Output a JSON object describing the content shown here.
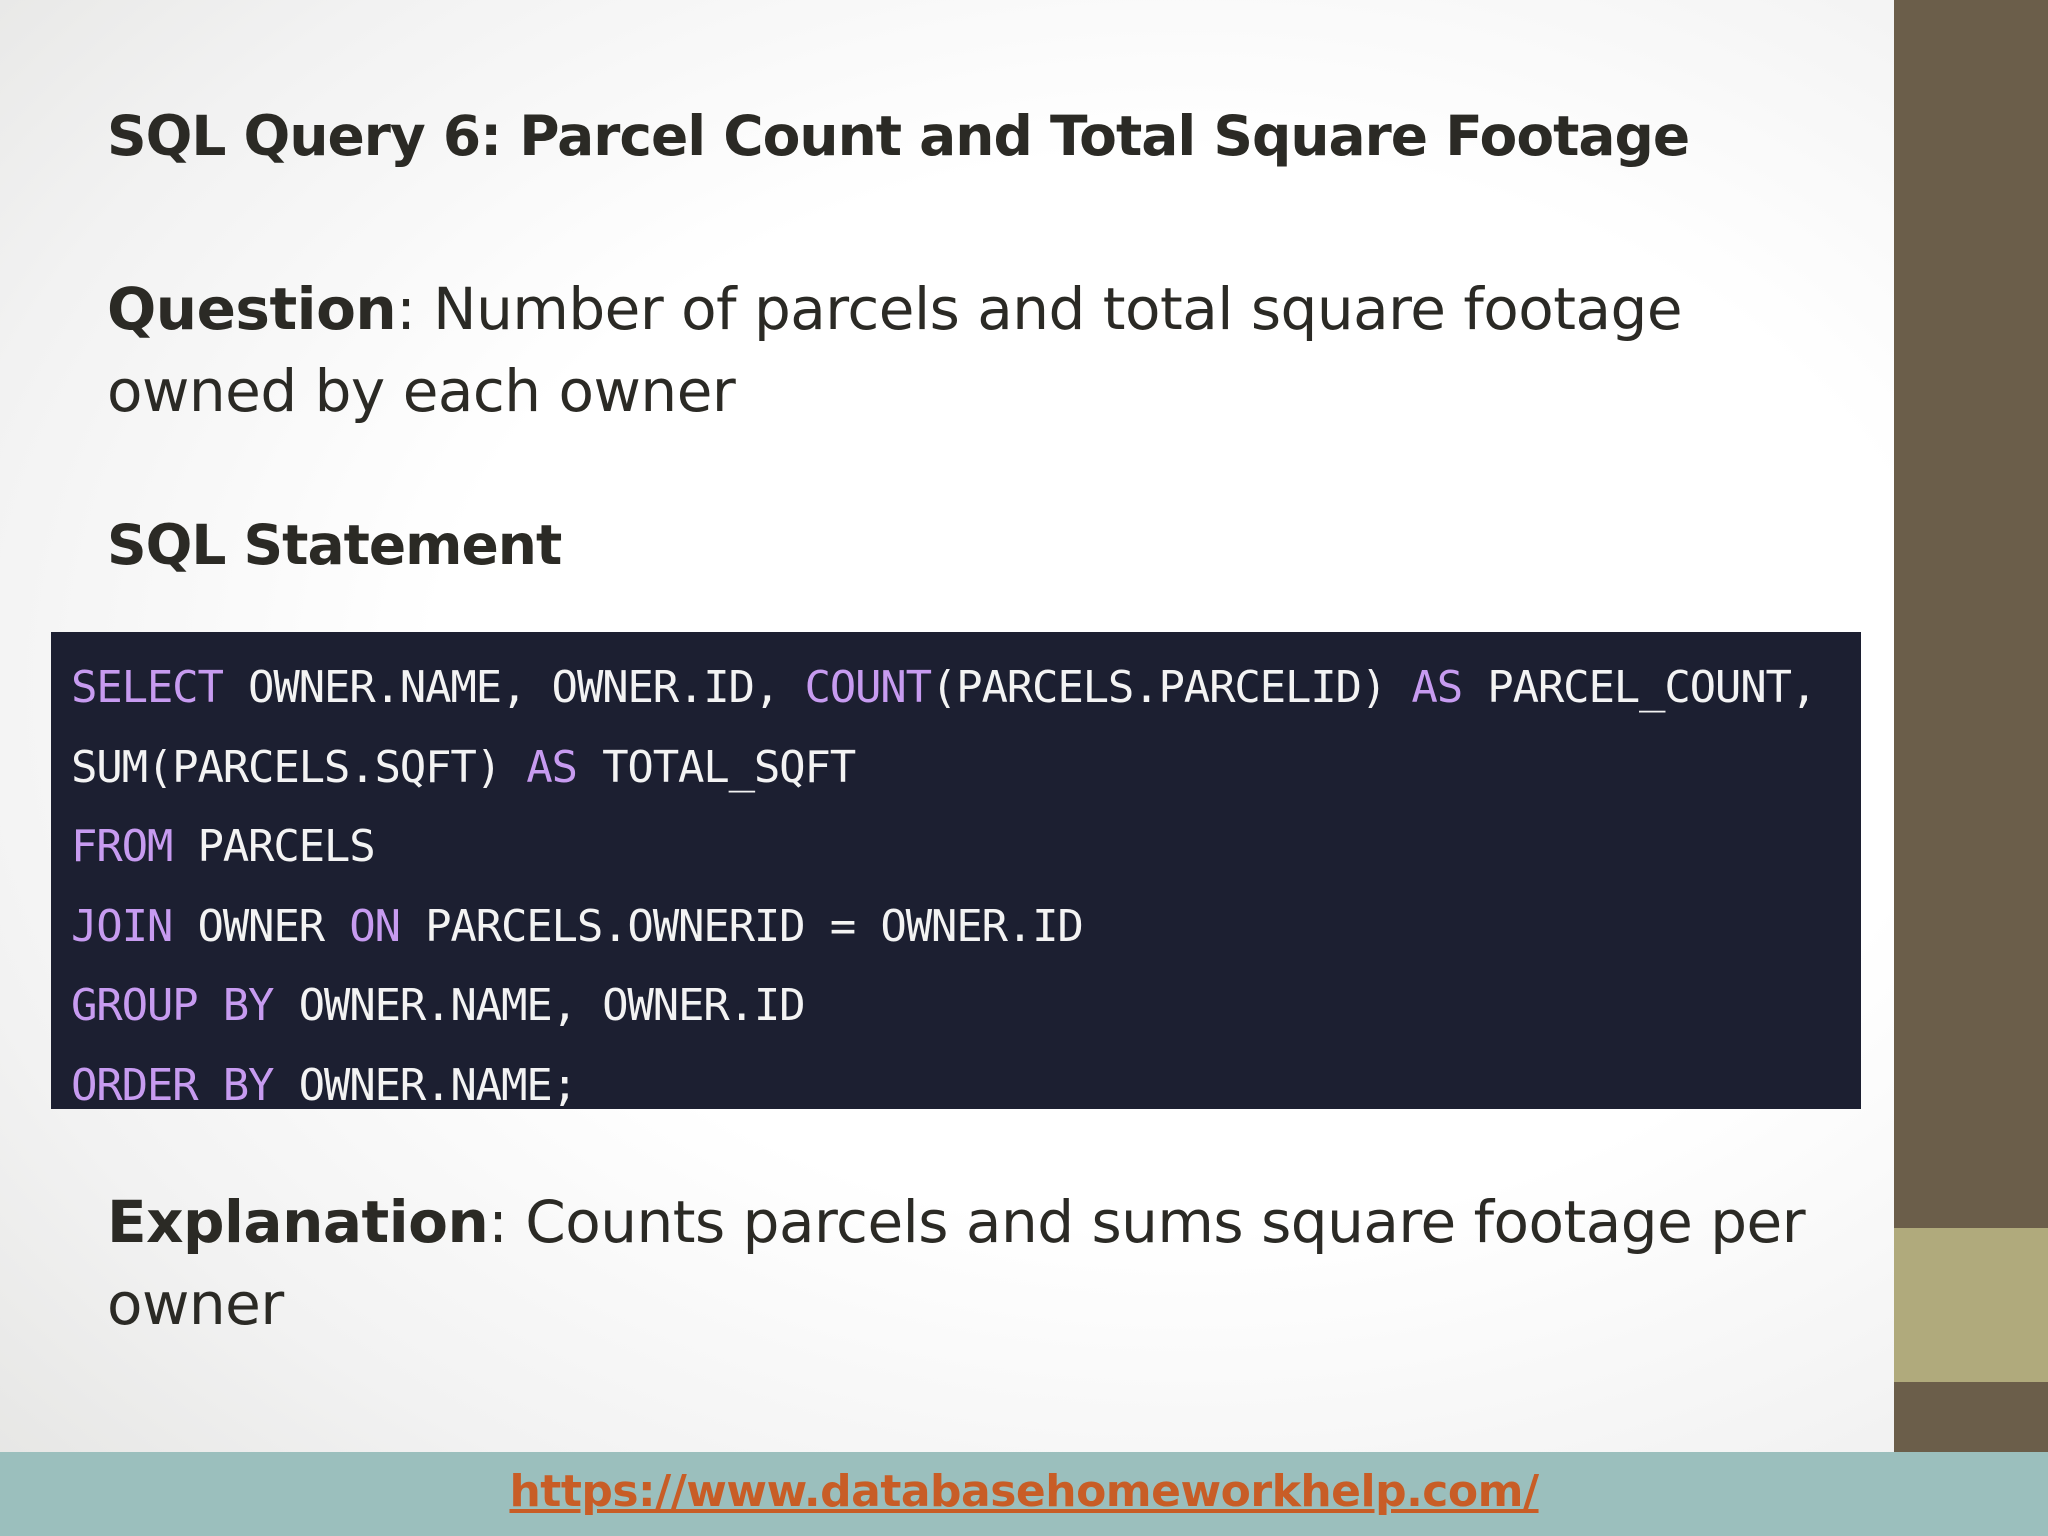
{
  "slide": {
    "title": "SQL Query 6: Parcel Count and Total Square Footage",
    "question_label": "Question",
    "question_text": ": Number of parcels and total square footage owned by each owner",
    "sql_heading": "SQL Statement",
    "explanation_label": "Explanation",
    "explanation_text": ": Counts parcels and sums square footage per owner"
  },
  "code": {
    "lines": [
      [
        {
          "kw": "SELECT"
        },
        {
          "t": " OWNER.NAME, OWNER.ID, "
        },
        {
          "kw": "COUNT"
        },
        {
          "t": "(PARCELS.PARCELID) "
        },
        {
          "kw": "AS"
        },
        {
          "t": " PARCEL_COUNT,"
        }
      ],
      [
        {
          "t": "SUM(PARCELS.SQFT) "
        },
        {
          "kw": "AS"
        },
        {
          "t": " TOTAL_SQFT"
        }
      ],
      [
        {
          "kw": "FROM"
        },
        {
          "t": " PARCELS"
        }
      ],
      [
        {
          "kw": "JOIN"
        },
        {
          "t": " OWNER "
        },
        {
          "kw": "ON"
        },
        {
          "t": " PARCELS.OWNERID = OWNER.ID"
        }
      ],
      [
        {
          "kw": "GROUP BY"
        },
        {
          "t": " OWNER.NAME, OWNER.ID"
        }
      ],
      [
        {
          "kw": "ORDER BY"
        },
        {
          "t": " OWNER.NAME;"
        }
      ]
    ]
  },
  "footer": {
    "link_text": "https://www.databasehomeworkhelp.com/"
  },
  "colors": {
    "keyword": "#c79bf0",
    "code_background": "#1c1f31",
    "footer_background": "#9bbfbd",
    "link": "#c85d26",
    "side_bar_dark": "#6b5e4a",
    "side_bar_light": "#b0aa7c"
  }
}
